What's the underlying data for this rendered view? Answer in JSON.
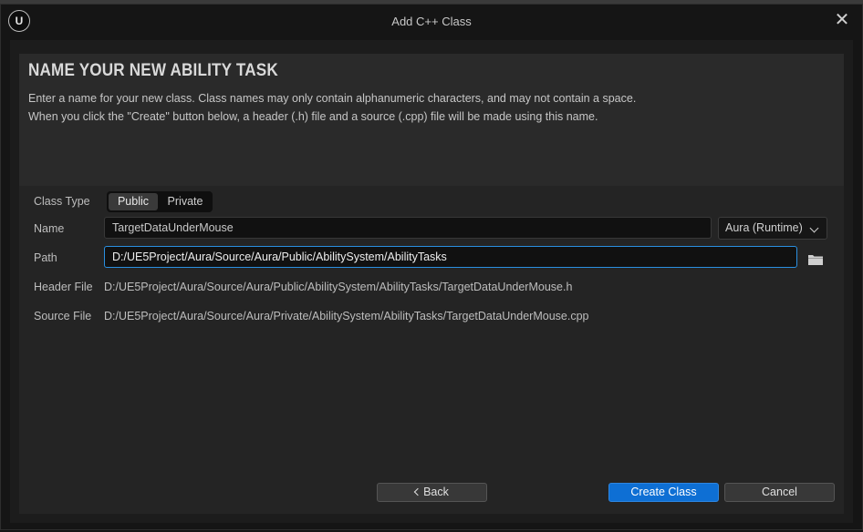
{
  "window": {
    "title": "Add C++ Class",
    "logo_icon": "unreal-engine-logo",
    "logo_text": "U",
    "close_icon": "close-icon",
    "close_glyph": "✕"
  },
  "header": {
    "heading": "NAME YOUR NEW ABILITY TASK",
    "description_line1": "Enter a name for your new class. Class names may only contain alphanumeric characters, and may not contain a space.",
    "description_line2": "When you click the \"Create\" button below, a header (.h) file and a source (.cpp) file will be made using this name."
  },
  "form": {
    "class_type": {
      "label": "Class Type",
      "options": [
        "Public",
        "Private"
      ],
      "selected": "Public"
    },
    "name": {
      "label": "Name",
      "value": "TargetDataUnderMouse",
      "module": "Aura (Runtime)"
    },
    "path": {
      "label": "Path",
      "value": "D:/UE5Project/Aura/Source/Aura/Public/AbilitySystem/AbilityTasks",
      "folder_icon": "folder-icon"
    },
    "header_file": {
      "label": "Header File",
      "value": "D:/UE5Project/Aura/Source/Aura/Public/AbilitySystem/AbilityTasks/TargetDataUnderMouse.h"
    },
    "source_file": {
      "label": "Source File",
      "value": "D:/UE5Project/Aura/Source/Aura/Private/AbilitySystem/AbilityTasks/TargetDataUnderMouse.cpp"
    }
  },
  "buttons": {
    "back": "Back",
    "create": "Create Class",
    "cancel": "Cancel"
  },
  "colors": {
    "accent": "#0e6fd4",
    "focus_border": "#2a8fe0"
  }
}
